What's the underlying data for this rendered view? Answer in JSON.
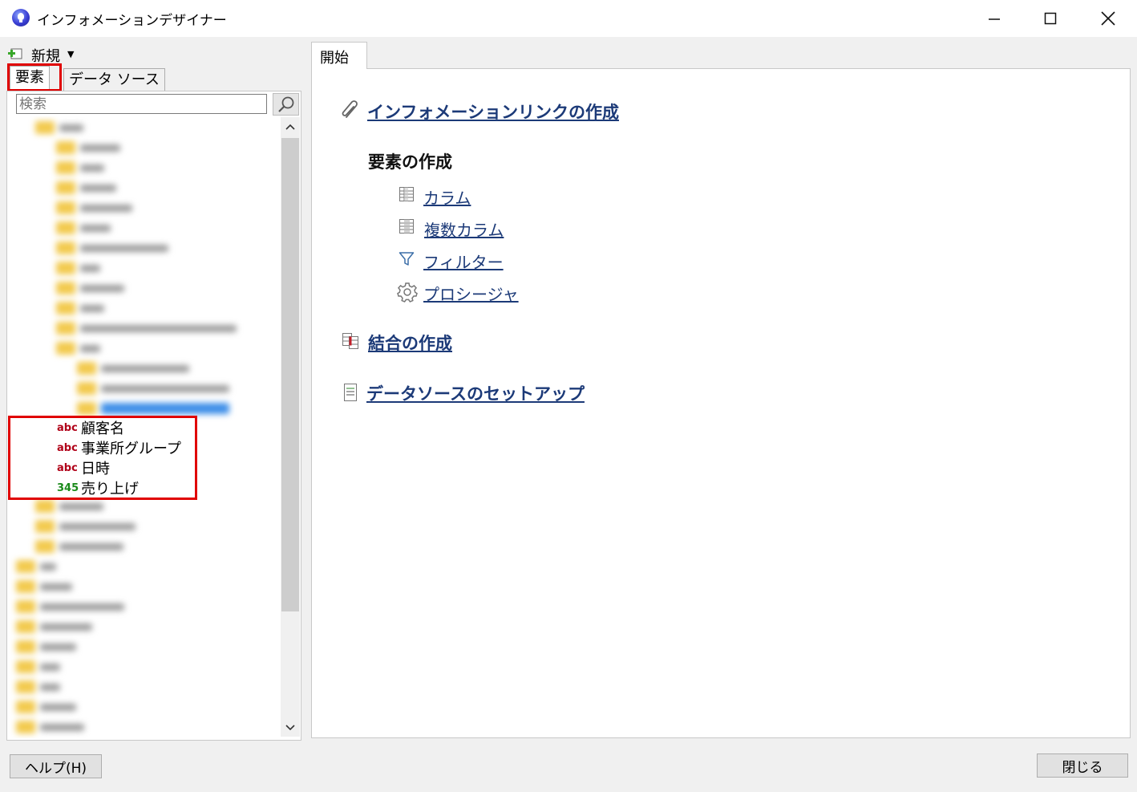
{
  "window": {
    "title": "インフォメーションデザイナー",
    "minimize_glyph": "—",
    "maximize_glyph": "☐",
    "close_glyph": "✕"
  },
  "toolbar": {
    "new_label": "新規",
    "new_caret": "▼"
  },
  "left_tabs": {
    "elements": "要素",
    "datasource": "データ ソース"
  },
  "search": {
    "placeholder": "検索"
  },
  "columns": [
    {
      "type": "abc",
      "name": "顧客名"
    },
    {
      "type": "abc",
      "name": "事業所グループ"
    },
    {
      "type": "abc",
      "name": "日時"
    },
    {
      "type": "345",
      "name": "売り上げ"
    }
  ],
  "right_tab": {
    "label": "開始"
  },
  "start": {
    "info_link": "インフォメーションリンクの作成",
    "elements_heading": "要素の作成",
    "column": "カラム",
    "multi_column": "複数カラム",
    "filter": "フィルター",
    "procedure": "プロシージャ",
    "join": "結合の作成",
    "datasource_setup": "データソースのセットアップ"
  },
  "footer": {
    "help": "ヘルプ(H)",
    "close": "閉じる"
  },
  "colors": {
    "highlight": "#e00000",
    "link": "#1c3a78",
    "string_type": "#b00018",
    "number_type": "#1a8a1a"
  }
}
